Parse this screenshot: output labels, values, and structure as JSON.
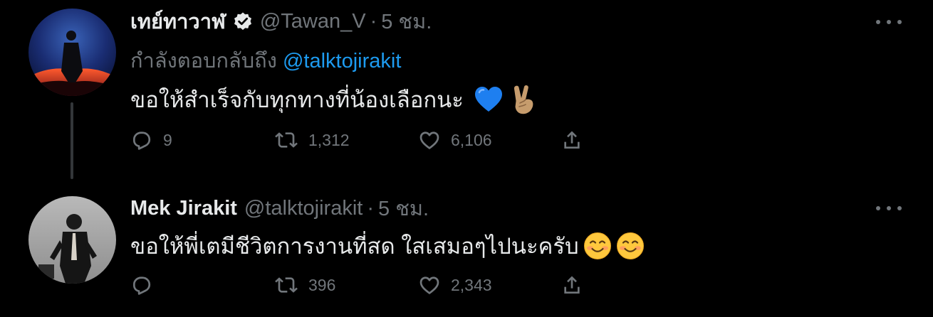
{
  "colors": {
    "background": "#000000",
    "primary_text": "#e7e9ea",
    "secondary_text": "#71767b",
    "link": "#1d9bf0",
    "thread_line": "#333639"
  },
  "tweets": [
    {
      "display_name": "เทย์ทาวาฬ",
      "verified": true,
      "handle": "@Tawan_V",
      "separator": "·",
      "time": "5 ชม.",
      "reply_prefix": "กำลังตอบกลับถึง",
      "reply_to": "@talktojirakit",
      "text": "ขอให้สำเร็จกับทุกทางที่น้องเลือกนะ",
      "emojis": [
        "blue-heart-icon",
        "victory-hand-icon"
      ],
      "counts": {
        "replies": "9",
        "retweets": "1,312",
        "likes": "6,106"
      }
    },
    {
      "display_name": "Mek Jirakit",
      "verified": false,
      "handle": "@talktojirakit",
      "separator": "·",
      "time": "5 ชม.",
      "text": "ขอให้พี่เตมีชีวิตการงานที่สด ใสเสมอๆไปนะครับ",
      "emojis": [
        "smiling-face-icon",
        "smiling-face-icon"
      ],
      "counts": {
        "replies": "",
        "retweets": "396",
        "likes": "2,343"
      }
    }
  ]
}
